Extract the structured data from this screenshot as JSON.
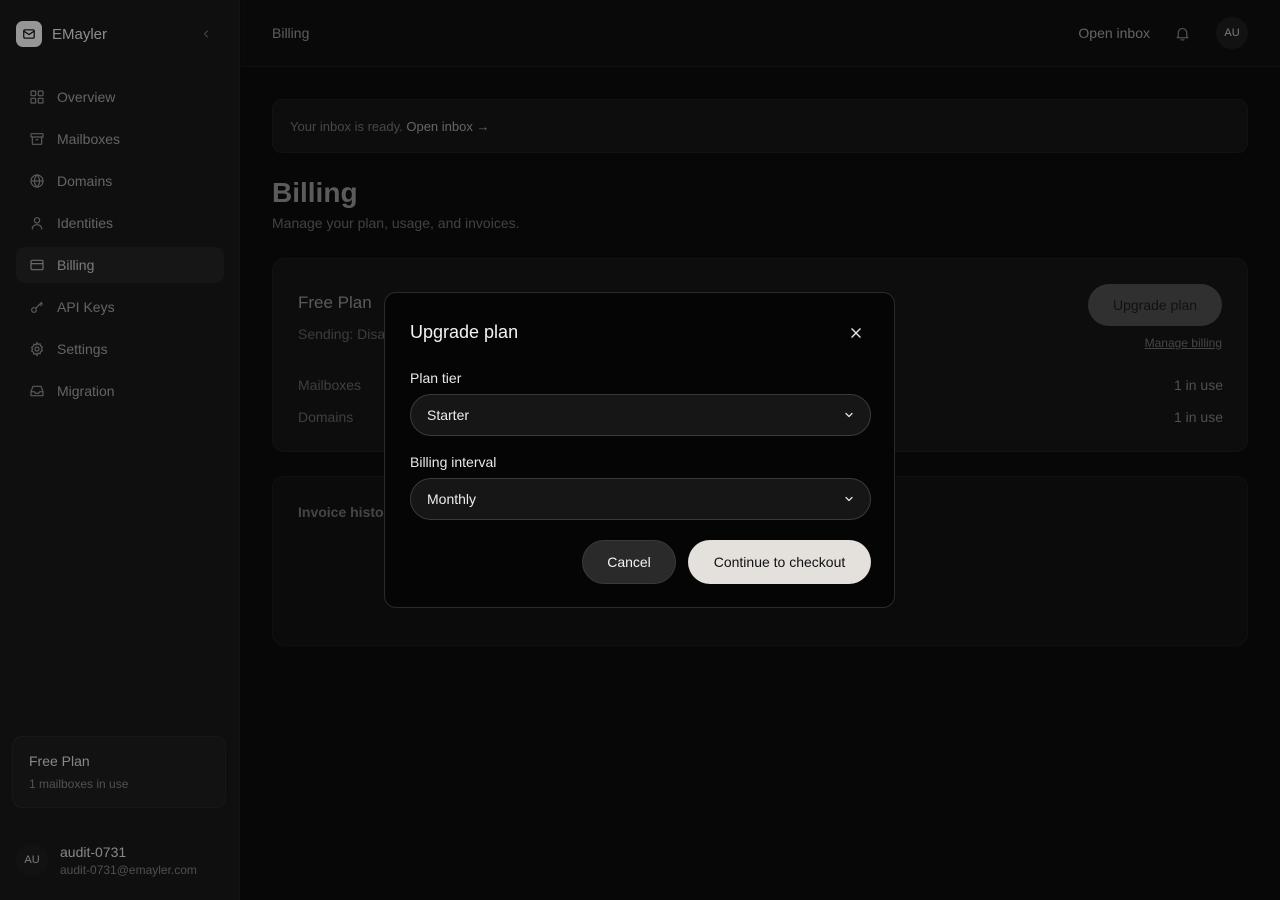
{
  "app": {
    "name": "EMayler"
  },
  "sidebar": {
    "items": [
      {
        "label": "Overview",
        "icon": "grid-icon"
      },
      {
        "label": "Mailboxes",
        "icon": "archive-icon"
      },
      {
        "label": "Domains",
        "icon": "globe-icon"
      },
      {
        "label": "Identities",
        "icon": "user-icon"
      },
      {
        "label": "Billing",
        "icon": "credit-card-icon",
        "active": true
      },
      {
        "label": "API Keys",
        "icon": "key-icon"
      },
      {
        "label": "Settings",
        "icon": "gear-icon"
      },
      {
        "label": "Migration",
        "icon": "inbox-icon"
      }
    ],
    "plan_card": {
      "title": "Free Plan",
      "subtitle": "1 mailboxes in use"
    },
    "user": {
      "initials": "AU",
      "name": "audit-0731",
      "email": "audit-0731@emayler.com"
    }
  },
  "header": {
    "breadcrumb": "Billing",
    "open_inbox": "Open inbox",
    "avatar_initials": "AU"
  },
  "banner": {
    "text": "Your inbox is ready.",
    "link": "Open inbox →"
  },
  "page": {
    "title": "Billing",
    "subtitle": "Manage your plan, usage, and invoices."
  },
  "plan": {
    "name": "Free Plan",
    "sending": "Sending: Disa",
    "upgrade_label": "Upgrade plan",
    "manage_label": "Manage billing",
    "rows": [
      {
        "label": "Mailboxes",
        "value": "1 in use"
      },
      {
        "label": "Domains",
        "value": "1 in use"
      }
    ]
  },
  "invoices": {
    "title": "Invoice histor"
  },
  "modal": {
    "title": "Upgrade plan",
    "tier_label": "Plan tier",
    "tier_value": "Starter",
    "interval_label": "Billing interval",
    "interval_value": "Monthly",
    "cancel_label": "Cancel",
    "continue_label": "Continue to checkout"
  },
  "colors": {
    "background": "#0b0b0b",
    "sidebar": "#171717",
    "modal": "#050505",
    "primary_button": "#e4e0dc"
  }
}
